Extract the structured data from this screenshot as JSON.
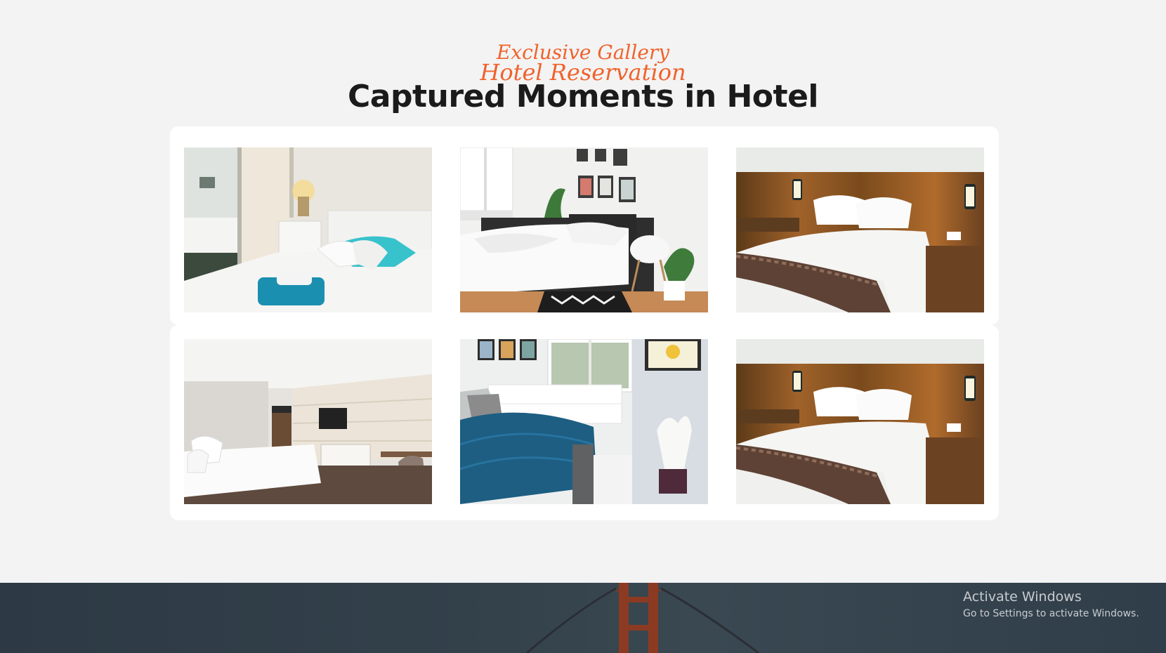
{
  "gallery": {
    "subtitle": "Exclusive Gallery",
    "title": "Captured Moments in Hotel",
    "images": [
      {
        "alt": "bedroom-with-mirror-and-teal-towels"
      },
      {
        "alt": "bright-bedroom-with-framed-posters"
      },
      {
        "alt": "hotel-bed-with-wood-headboard"
      },
      {
        "alt": "modern-hotel-room-with-tv-wall"
      },
      {
        "alt": "bedroom-with-blue-quilt-and-window"
      },
      {
        "alt": "hotel-bed-with-wood-headboard"
      }
    ]
  },
  "footer": {
    "section_title": "Hotel Reservation"
  },
  "windows_notice": {
    "title": "Activate Windows",
    "subtitle": "Go to Settings to activate Windows."
  },
  "colors": {
    "accent": "#f0622c",
    "heading": "#1b1b1b",
    "background": "#f3f3f3",
    "footer": "#33414b"
  }
}
